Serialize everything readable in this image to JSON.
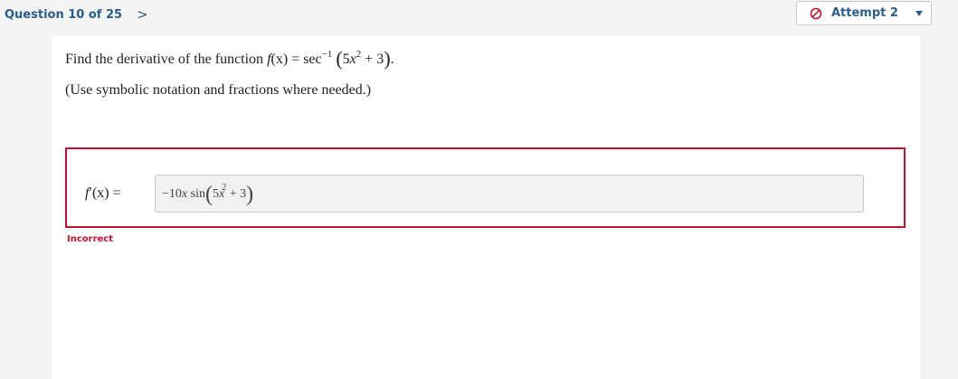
{
  "header": {
    "question_label": "Question 10 of 25",
    "next_glyph": ">",
    "attempt_label": "Attempt 2"
  },
  "question": {
    "prompt_prefix": "Find the derivative of the function ",
    "prompt_fx": "f",
    "prompt_var": "(x)",
    "prompt_eq": " = sec",
    "prompt_exp": "−1",
    "prompt_inner_coef": "5",
    "prompt_inner_var": "x",
    "prompt_inner_pow": "2",
    "prompt_inner_rest": " + 3",
    "prompt_end": ".",
    "instruction": "(Use symbolic notation and fractions where needed.)"
  },
  "answer": {
    "lhs_f": "f",
    "lhs_rest": "′(x) =",
    "value_coef": "−10",
    "value_var": "x",
    "value_fn": " sin",
    "value_inner_coef": "5",
    "value_inner_var": "x",
    "value_inner_pow": "2",
    "value_inner_rest": " + 3",
    "status": "Incorrect"
  },
  "colors": {
    "accent": "#2a5d8f",
    "error": "#c8102e",
    "background": "#f4f4f4",
    "panel": "#ffffff"
  },
  "icons": {
    "attempt": "ban-icon",
    "dropdown": "caret-down-icon",
    "next": "chevron-right-icon"
  }
}
